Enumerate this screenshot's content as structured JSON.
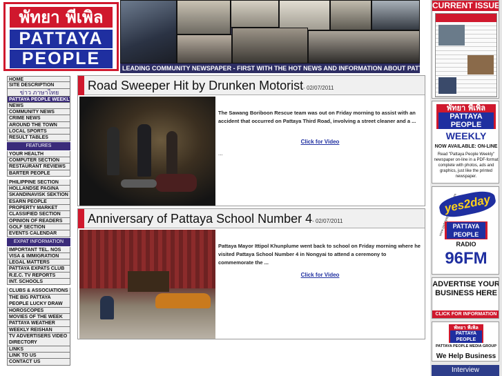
{
  "header": {
    "logo_thai": "พัทยา พีเพิล",
    "logo_line1": "PATTAYA",
    "logo_line2": "PEOPLE",
    "tagline": "LEADING COMMUNITY NEWSPAPER - FIRST WITH THE HOT NEWS AND INFORMATION ABOUT PATTAYA"
  },
  "nav": {
    "group1": [
      "HOME",
      "SITE DESCRIPTION"
    ],
    "thai_link": "ข่าว ภาษาไทย",
    "weekly": "PATTAYA PEOPLE WEEKLY",
    "group2": [
      "NEWS",
      "COMMUNITY NEWS",
      "CRIME NEWS",
      "AROUND THE TOWN",
      "LOCAL SPORTS",
      "RESULT TABLES"
    ],
    "features_head": "FEATURES",
    "group3": [
      "YOUR HEALTH",
      "COMPUTER SECTION",
      "RESTAURANT REVIEWS",
      "BARTER PEOPLE"
    ],
    "group4": [
      "PHILIPPINE SECTION",
      "HOLLANDSE PAGINA",
      "SKANDINAVISK SEKTION",
      "ESARN PEOPLE",
      "PROPERTY MARKET",
      "CLASSIFIED SECTION",
      "OPINION OF READERS",
      "GOLF SECTION",
      "EVENTS CALENDAR"
    ],
    "expat_head": "EXPAT INFORMATION",
    "group5": [
      "IMPORTANT TEL. NOS",
      "VISA & IMMIGRATION",
      "LEGAL MATTERS",
      "PATTAYA EXPATS CLUB",
      "R.E.C. TV REPORTS",
      "INT. SCHOOLS"
    ],
    "group6": [
      "CLUBS & ASSOCIATIONS",
      "THE BIG PATTAYA PEOPLE LUCKY DRAW",
      "HOROSCOPES",
      "MOVIES OF THE WEEK",
      "PATTAYA WEATHER",
      "WEEKLY REISHAN",
      "TV ADVERTISERS VIDEO DIRECTORY",
      "LINKS",
      "LINK TO US",
      "CONTACT US"
    ]
  },
  "articles": [
    {
      "title": "Road Sweeper Hit by Drunken Motorist",
      "date": "- 02/07/2011",
      "body": "The Sawang Boriboon Rescue team was out on Friday morning to assist with an accident that occurred on Pattaya Third Road, involving a street cleaner and a ...",
      "video_link": "Click for Video",
      "ellipsis": "..."
    },
    {
      "title": "Anniversary of Pattaya School Number 4",
      "date": "- 02/07/2011",
      "body": "Pattaya Mayor Ittipol Khunplume went back to school on Friday morning where he visited Pattaya School Number 4 in Nongyai to attend a ceremony to commemorate the ...",
      "video_link": "Click for Video"
    }
  ],
  "right": {
    "current_issue": "CURRENT ISSUE",
    "weekly_thai": "พัทยา พีเพิล",
    "weekly_l1": "PATTAYA",
    "weekly_l2": "PEOPLE",
    "weekly_word": "WEEKLY",
    "weekly_now": "NOW AVAILABLE: ON-LINE",
    "weekly_desc": "Read \"Pattaya People Weekly\" newspaper on-line in a PDF-format complete with photos, ads and graphics, just like the printed newspaper.",
    "radio_yes": "yes2day",
    "radio_url": "www.pattayapeopleradio.com",
    "radio_l1": "PATTAYA",
    "radio_l2": "PEOPLE",
    "radio_word": "RADIO",
    "radio_freq": "96FM",
    "advertise": "ADVERTISE YOUR BUSINESS HERE",
    "advertise_link": "CLICK FOR INFORMATION",
    "media_thai": "พัทยา พีเพิล",
    "media_l1": "PATTAYA",
    "media_l2": "PEOPLE",
    "media_group": "PATTAYA PEOPLE MEDIA GROUP",
    "media_helps": "We Help Business",
    "interview": "Interview"
  },
  "colors": {
    "brand_red": "#d0182d",
    "brand_blue": "#1f2fa0",
    "nav_purple": "#3a2b7a"
  }
}
